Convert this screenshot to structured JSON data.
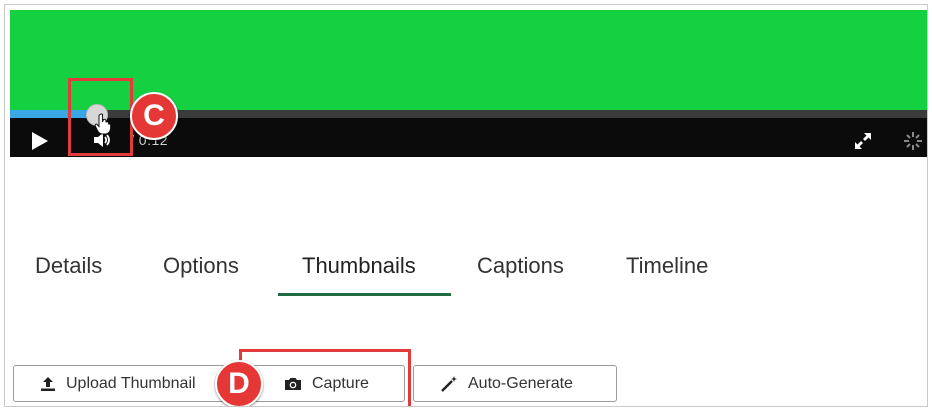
{
  "video": {
    "time_display": "/ 0:12",
    "progress_fraction": 0.09,
    "colors": {
      "frame": "#15d041",
      "progress": "#39a7e4",
      "controlbar": "#0b0b0b"
    }
  },
  "annotations": {
    "c": "C",
    "d": "D",
    "highlight_color": "#e23b3b"
  },
  "tabs": {
    "active": "Thumbnails",
    "items": [
      {
        "label": "Details"
      },
      {
        "label": "Options"
      },
      {
        "label": "Thumbnails"
      },
      {
        "label": "Captions"
      },
      {
        "label": "Timeline"
      }
    ],
    "accent": "#1d6a43"
  },
  "buttons": {
    "upload": {
      "label": "Upload Thumbnail",
      "icon": "upload-icon"
    },
    "capture": {
      "label": "Capture",
      "icon": "camera-icon"
    },
    "auto": {
      "label": "Auto-Generate",
      "icon": "magic-wand-icon"
    }
  }
}
